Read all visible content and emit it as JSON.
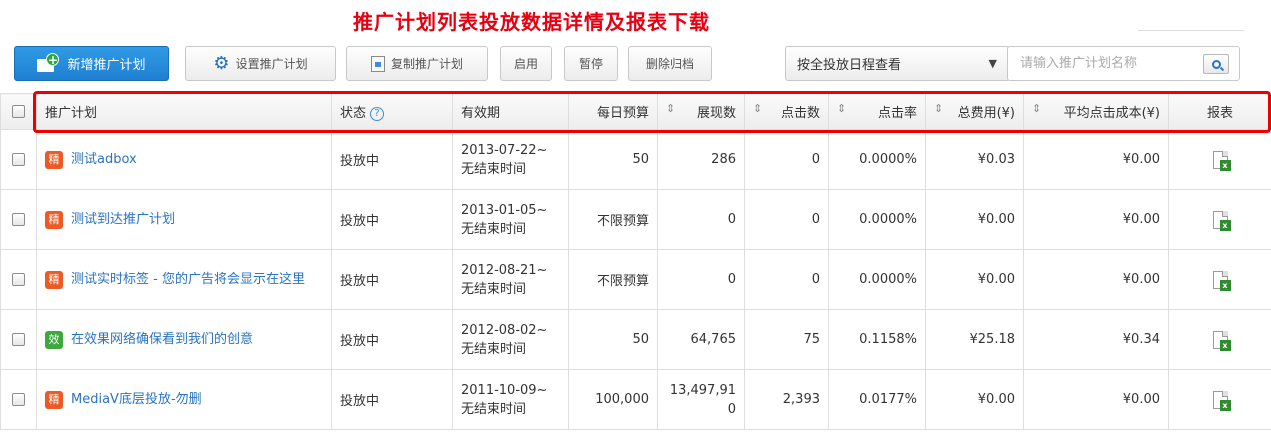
{
  "caption": "推广计划列表投放数据详情及报表下载",
  "toolbar": {
    "new_plan": "新增推广计划",
    "settings": "设置推广计划",
    "copy": "复制推广计划",
    "enable": "启用",
    "pause": "暂停",
    "archive": "删除归档",
    "schedule_select": "按全投放日程查看",
    "search_placeholder": "请输入推广计划名称"
  },
  "table": {
    "headers": {
      "plan": "推广计划",
      "status": "状态",
      "period": "有效期",
      "budget": "每日预算",
      "impressions": "展现数",
      "clicks": "点击数",
      "ctr": "点击率",
      "cost": "总费用(¥)",
      "cpc": "平均点击成本(¥)",
      "report": "报表"
    },
    "rows": [
      {
        "badge": "精",
        "badge_type": "jing",
        "name": "测试adbox",
        "status": "投放中",
        "start": "2013-07-22~",
        "end": "无结束时间",
        "budget": "50",
        "impressions": "286",
        "clicks": "0",
        "ctr": "0.0000%",
        "cost": "¥0.03",
        "cpc": "¥0.00"
      },
      {
        "badge": "精",
        "badge_type": "jing",
        "name": "测试到达推广计划",
        "status": "投放中",
        "start": "2013-01-05~",
        "end": "无结束时间",
        "budget": "不限预算",
        "impressions": "0",
        "clicks": "0",
        "ctr": "0.0000%",
        "cost": "¥0.00",
        "cpc": "¥0.00"
      },
      {
        "badge": "精",
        "badge_type": "jing",
        "name": "测试实时标签 - 您的广告将会显示在这里",
        "status": "投放中",
        "start": "2012-08-21~",
        "end": "无结束时间",
        "budget": "不限预算",
        "impressions": "0",
        "clicks": "0",
        "ctr": "0.0000%",
        "cost": "¥0.00",
        "cpc": "¥0.00"
      },
      {
        "badge": "效",
        "badge_type": "xiao",
        "name": "在效果网络确保看到我们的创意",
        "status": "投放中",
        "start": "2012-08-02~",
        "end": "无结束时间",
        "budget": "50",
        "impressions": "64,765",
        "clicks": "75",
        "ctr": "0.1158%",
        "cost": "¥25.18",
        "cpc": "¥0.34"
      },
      {
        "badge": "精",
        "badge_type": "jing",
        "name": "MediaV底层投放-勿删",
        "status": "投放中",
        "start": "2011-10-09~",
        "end": "无结束时间",
        "budget": "100,000",
        "impressions": "13,497,910",
        "clicks": "2,393",
        "ctr": "0.0177%",
        "cost": "¥0.00",
        "cpc": "¥0.00"
      }
    ]
  },
  "icons": {
    "new": "new-plan-icon",
    "settings": "gears-icon",
    "copy": "copy-icon",
    "search": "search-icon",
    "help": "help-icon",
    "report": "excel-download-icon"
  },
  "colors": {
    "caption": "#e60012",
    "highlight": "#ee0000",
    "link": "#2a73c2",
    "primary": "#1f7fd1",
    "badge_jing": "#ee5a24",
    "badge_xiao": "#3da83d"
  }
}
